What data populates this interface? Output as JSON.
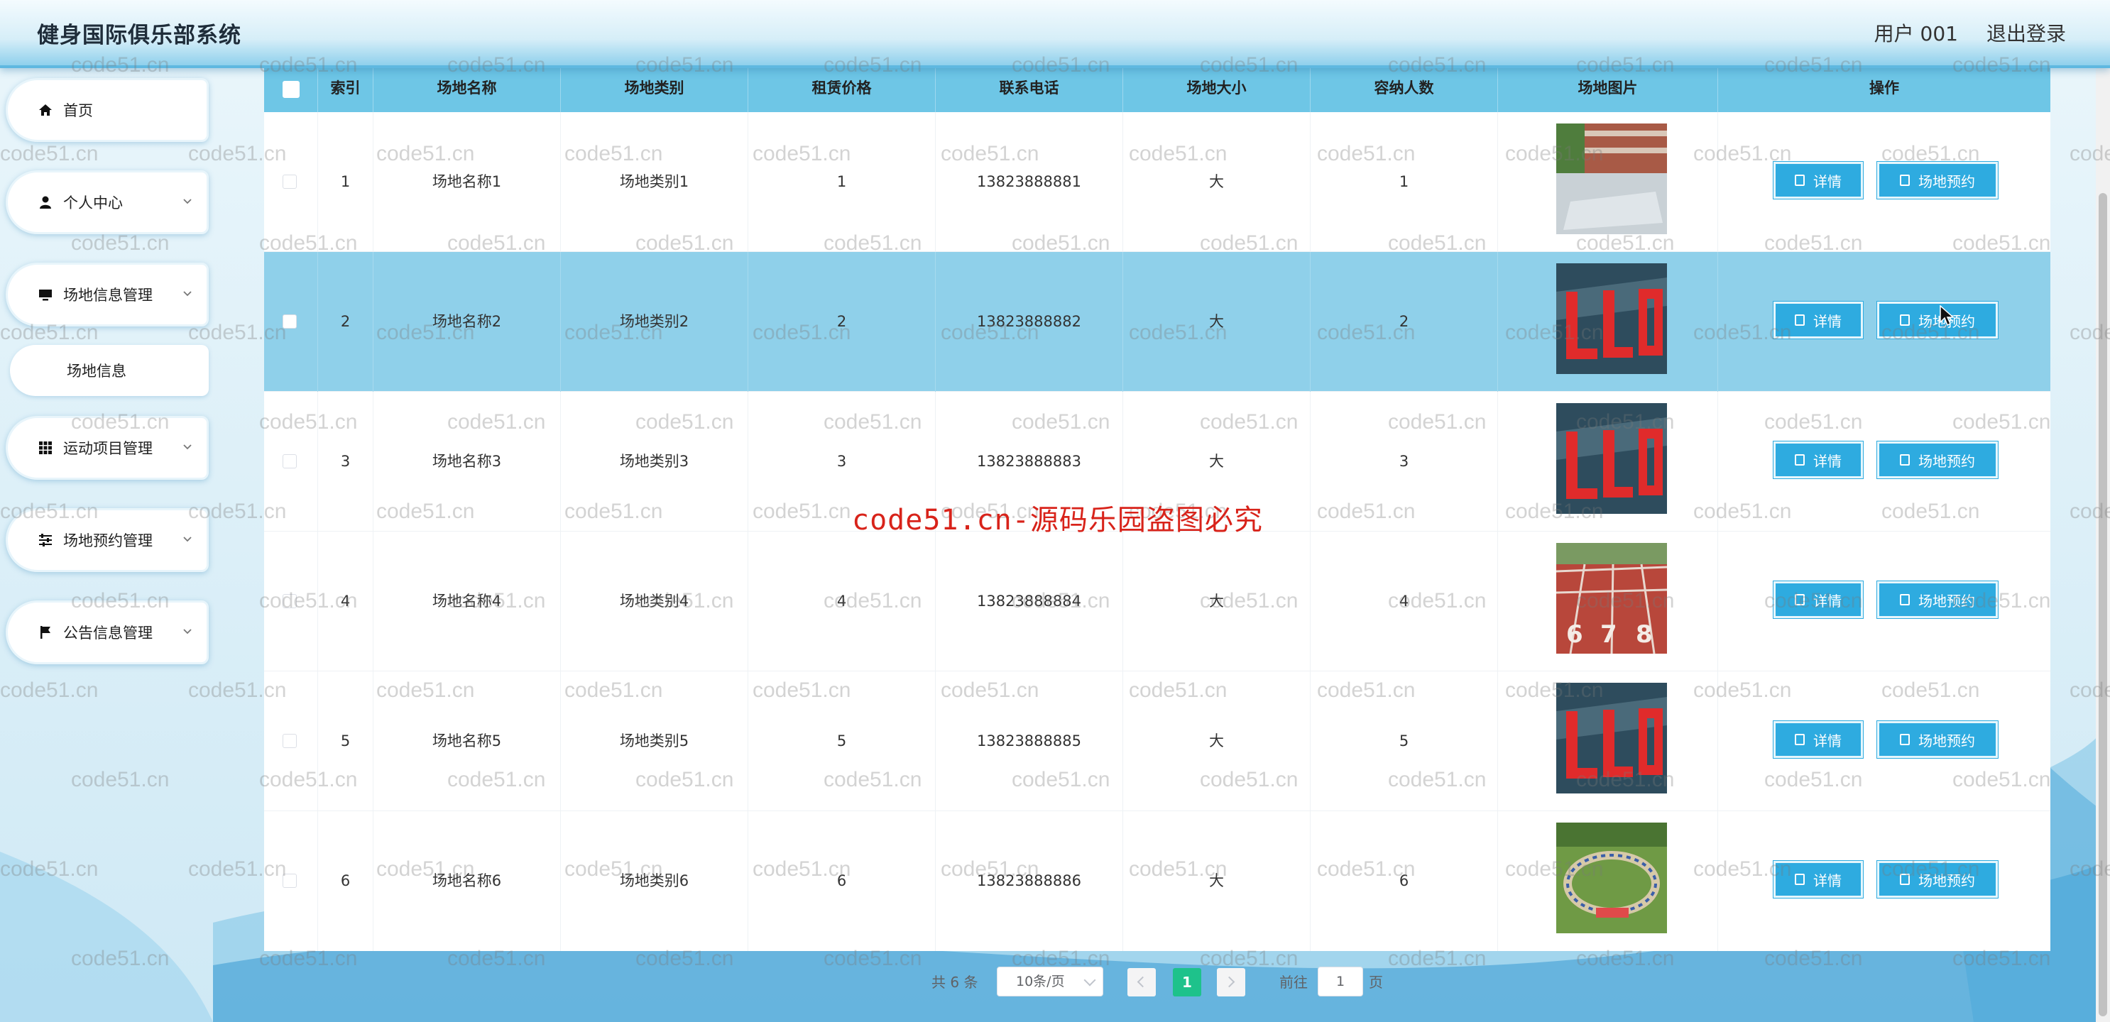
{
  "header": {
    "app_title": "健身国际俱乐部系统",
    "user_label": "用户 001",
    "logout_label": "退出登录"
  },
  "sidebar": {
    "items": [
      {
        "label": "首页",
        "icon": "home-icon",
        "has_chevron": false
      },
      {
        "label": "个人中心",
        "icon": "user-icon",
        "has_chevron": true
      },
      {
        "label": "场地信息管理",
        "icon": "monitor-icon",
        "has_chevron": true
      },
      {
        "label": "场地信息",
        "icon": "",
        "has_chevron": false,
        "sub": true
      },
      {
        "label": "运动项目管理",
        "icon": "grid-icon",
        "has_chevron": true
      },
      {
        "label": "场地预约管理",
        "icon": "sliders-icon",
        "has_chevron": true
      },
      {
        "label": "公告信息管理",
        "icon": "flag-icon",
        "has_chevron": true
      }
    ]
  },
  "table": {
    "columns": [
      "索引",
      "场地名称",
      "场地类别",
      "租赁价格",
      "联系电话",
      "场地大小",
      "容纳人数",
      "场地图片",
      "操作"
    ],
    "rows": [
      {
        "index": "1",
        "name": "场地名称1",
        "category": "场地类别1",
        "price": "1",
        "phone": "13823888881",
        "size": "大",
        "capacity": "1",
        "image": "campus-court-photo"
      },
      {
        "index": "2",
        "name": "场地名称2",
        "category": "场地类别2",
        "price": "2",
        "phone": "13823888882",
        "size": "大",
        "capacity": "2",
        "image": "red-letters-field-photo"
      },
      {
        "index": "3",
        "name": "场地名称3",
        "category": "场地类别3",
        "price": "3",
        "phone": "13823888883",
        "size": "大",
        "capacity": "3",
        "image": "red-letters-field-photo"
      },
      {
        "index": "4",
        "name": "场地名称4",
        "category": "场地类别4",
        "price": "4",
        "phone": "13823888884",
        "size": "大",
        "capacity": "4",
        "image": "running-track-photo"
      },
      {
        "index": "5",
        "name": "场地名称5",
        "category": "场地类别5",
        "price": "5",
        "phone": "13823888885",
        "size": "大",
        "capacity": "5",
        "image": "red-letters-field-photo"
      },
      {
        "index": "6",
        "name": "场地名称6",
        "category": "场地类别6",
        "price": "6",
        "phone": "13823888886",
        "size": "大",
        "capacity": "6",
        "image": "crowd-circle-photo"
      }
    ],
    "highlighted_row": 2,
    "detail_label": "详情",
    "book_label": "场地预约"
  },
  "pagination": {
    "total_text": "共 6 条",
    "page_size": "10条/页",
    "current_page": "1",
    "goto_prefix": "前往",
    "goto_value": "1",
    "goto_suffix": "页"
  },
  "watermark": {
    "center_text": "code51.cn-源码乐园盗图必究",
    "tile_text": "code51.cn"
  },
  "colors": {
    "accent": "#2eabe0",
    "header_row": "#6ec6e6",
    "highlight_row": "#8fd0ea",
    "pager_active": "#1ec28b",
    "watermark_red": "#d8231a"
  }
}
